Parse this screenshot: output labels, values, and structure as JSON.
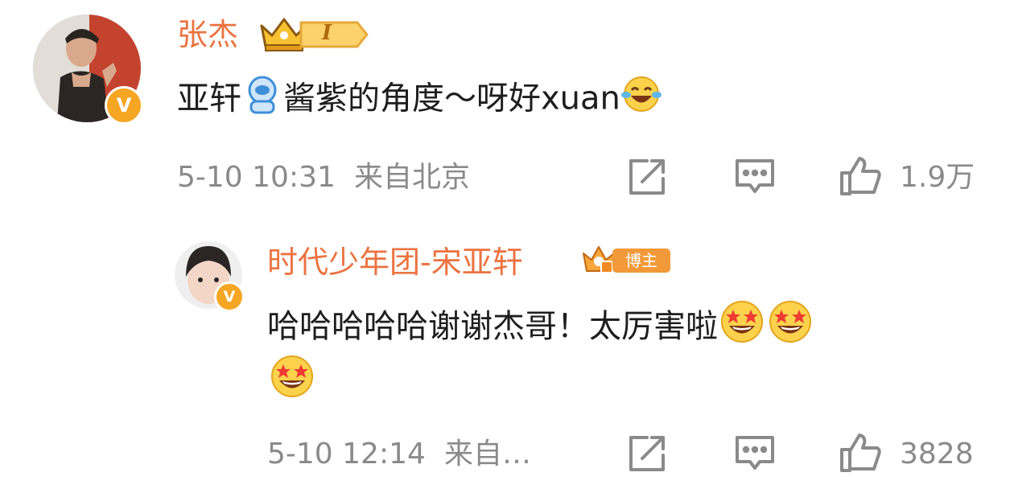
{
  "comments": [
    {
      "author": "张杰",
      "fan_level": "I",
      "verified_badge": "V",
      "text_part1": "亚轩",
      "text_part2": "酱紫的角度～呀好xuan",
      "text_emojis": [
        "astronaut-emoji",
        "laughing-tears-emoji"
      ],
      "time": "5-10 10:31",
      "location": "来自北京",
      "like_count": "1.9万"
    },
    {
      "author": "时代少年团-宋亚轩",
      "author_badge": "博主",
      "verified_badge": "V",
      "text_line1": "哈哈哈哈哈谢谢杰哥！太厉害啦",
      "text_emojis": [
        "star-struck-emoji",
        "star-struck-emoji",
        "star-struck-emoji"
      ],
      "time": "5-10 12:14",
      "location": "来自…",
      "like_count": "3828"
    }
  ],
  "icons": [
    "share-icon",
    "comment-icon",
    "like-icon"
  ],
  "colors": {
    "name": "#eb7340",
    "meta": "#8a8a8a",
    "badge": "#f5a623",
    "text": "#1e1e1e"
  }
}
